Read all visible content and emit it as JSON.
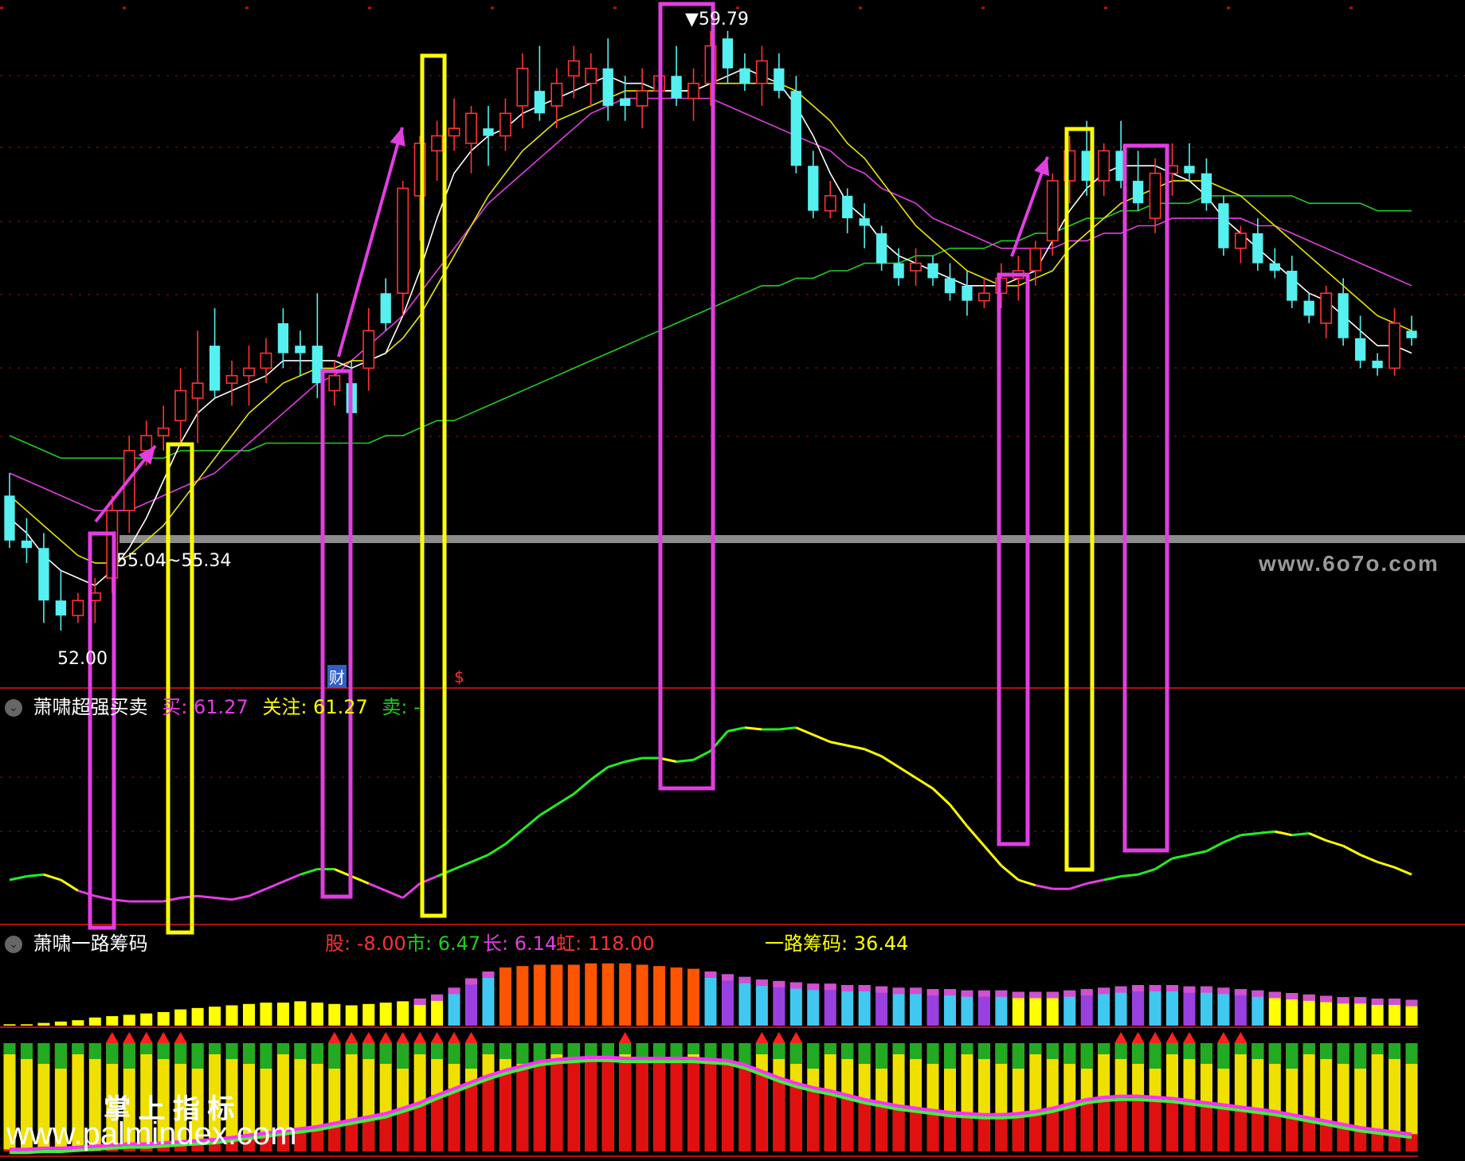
{
  "top_label": {
    "prefix": "▼",
    "price_high": "59.79",
    "price_mid": "55.04~55.34",
    "price_low": "52.00"
  },
  "markers": {
    "cai": "财",
    "s": "$"
  },
  "panel2": {
    "icon": "chevron-down-icon",
    "title": "萧啸超强买卖",
    "buy_label": "买: 61.27",
    "watch_label": "关注: 61.27",
    "sell_label": "卖: -"
  },
  "panel3": {
    "icon": "chevron-down-icon",
    "title": "萧啸一路筹码",
    "gu": "股: -8.00",
    "shi": "市: 6.47",
    "chang": "长: 6.14",
    "hong": "虹: 118.00",
    "yilu": "一路筹码: 36.44"
  },
  "watermarks": {
    "top": "www.6o7o.com",
    "cn": "掌 上 指 标",
    "bottom": "www.palmindex.com"
  },
  "colors": {
    "bg": "#000000",
    "up": "#ff3333",
    "down": "#55f0f0",
    "ma5": "#ffffff",
    "ma10": "#e8e800",
    "ma20": "#e23ee2",
    "ma60": "#22cc22",
    "box_magenta": "#e23ee2",
    "box_yellow": "#ffff00",
    "grid": "#8a1414"
  },
  "chart_data": [
    {
      "type": "candlestick",
      "title": "",
      "annotations": [
        "59.79",
        "55.04~55.34",
        "52.00"
      ],
      "ohlc": [
        [
          53.6,
          53.9,
          52.9,
          53.0
        ],
        [
          53.0,
          53.3,
          52.7,
          52.9
        ],
        [
          52.9,
          53.1,
          51.9,
          52.2
        ],
        [
          52.2,
          52.6,
          51.8,
          52.0
        ],
        [
          52.0,
          52.3,
          51.9,
          52.2
        ],
        [
          52.2,
          52.5,
          51.9,
          52.3
        ],
        [
          52.5,
          53.6,
          52.3,
          53.4
        ],
        [
          53.4,
          54.4,
          53.1,
          54.2
        ],
        [
          54.2,
          54.6,
          54.0,
          54.4
        ],
        [
          54.4,
          54.8,
          54.2,
          54.5
        ],
        [
          54.6,
          55.3,
          54.3,
          55.0
        ],
        [
          54.9,
          55.8,
          54.3,
          55.1
        ],
        [
          55.6,
          56.1,
          54.9,
          55.0
        ],
        [
          55.1,
          55.4,
          54.8,
          55.2
        ],
        [
          55.2,
          55.6,
          54.8,
          55.3
        ],
        [
          55.3,
          55.7,
          55.1,
          55.5
        ],
        [
          55.9,
          56.1,
          55.3,
          55.5
        ],
        [
          55.6,
          55.8,
          55.2,
          55.5
        ],
        [
          55.6,
          56.3,
          54.9,
          55.1
        ],
        [
          55.0,
          55.4,
          54.8,
          55.2
        ],
        [
          55.1,
          55.4,
          54.6,
          54.7
        ],
        [
          55.3,
          56.1,
          55.0,
          55.8
        ],
        [
          56.3,
          56.5,
          55.8,
          55.9
        ],
        [
          56.3,
          57.8,
          56.0,
          57.7
        ],
        [
          57.6,
          58.4,
          57.0,
          58.3
        ],
        [
          58.2,
          58.6,
          57.8,
          58.4
        ],
        [
          58.4,
          58.9,
          58.2,
          58.5
        ],
        [
          58.3,
          58.8,
          57.9,
          58.7
        ],
        [
          58.5,
          58.8,
          58.0,
          58.4
        ],
        [
          58.4,
          58.9,
          58.2,
          58.7
        ],
        [
          58.8,
          59.5,
          58.5,
          59.3
        ],
        [
          59.0,
          59.6,
          58.6,
          58.7
        ],
        [
          58.8,
          59.3,
          58.5,
          59.1
        ],
        [
          59.2,
          59.6,
          58.9,
          59.4
        ],
        [
          59.1,
          59.5,
          58.8,
          59.3
        ],
        [
          59.3,
          59.7,
          58.6,
          58.8
        ],
        [
          58.9,
          59.2,
          58.6,
          58.8
        ],
        [
          58.8,
          59.3,
          58.5,
          59.0
        ],
        [
          59.0,
          59.4,
          58.7,
          59.2
        ],
        [
          59.2,
          59.6,
          58.8,
          58.9
        ],
        [
          58.9,
          59.3,
          58.6,
          59.1
        ],
        [
          59.1,
          59.8,
          58.8,
          59.6
        ],
        [
          59.7,
          59.8,
          59.1,
          59.3
        ],
        [
          59.3,
          59.5,
          59.0,
          59.1
        ],
        [
          59.1,
          59.6,
          58.8,
          59.4
        ],
        [
          59.3,
          59.5,
          58.9,
          59.0
        ],
        [
          59.0,
          59.2,
          57.9,
          58.0
        ],
        [
          58.0,
          58.2,
          57.3,
          57.4
        ],
        [
          57.4,
          57.8,
          57.3,
          57.6
        ],
        [
          57.6,
          57.7,
          57.1,
          57.3
        ],
        [
          57.3,
          57.5,
          56.9,
          57.2
        ],
        [
          57.1,
          57.2,
          56.6,
          56.7
        ],
        [
          56.7,
          56.9,
          56.4,
          56.5
        ],
        [
          56.6,
          56.9,
          56.4,
          56.7
        ],
        [
          56.7,
          56.8,
          56.4,
          56.5
        ],
        [
          56.5,
          56.7,
          56.2,
          56.3
        ],
        [
          56.4,
          56.6,
          56.0,
          56.2
        ],
        [
          56.2,
          56.5,
          56.1,
          56.3
        ],
        [
          56.3,
          56.7,
          56.1,
          56.5
        ],
        [
          56.5,
          56.8,
          56.2,
          56.6
        ],
        [
          56.6,
          57.0,
          56.4,
          56.9
        ],
        [
          57.0,
          57.9,
          56.8,
          57.8
        ],
        [
          57.8,
          58.4,
          57.5,
          58.2
        ],
        [
          58.2,
          58.6,
          57.6,
          57.8
        ],
        [
          57.8,
          58.3,
          57.6,
          58.2
        ],
        [
          58.2,
          58.6,
          57.7,
          57.8
        ],
        [
          57.8,
          58.2,
          57.4,
          57.5
        ],
        [
          57.3,
          58.1,
          57.1,
          57.9
        ],
        [
          57.9,
          58.3,
          57.6,
          58.0
        ],
        [
          58.0,
          58.3,
          57.8,
          57.9
        ],
        [
          57.9,
          58.1,
          57.4,
          57.5
        ],
        [
          57.5,
          57.6,
          56.8,
          56.9
        ],
        [
          56.9,
          57.2,
          56.7,
          57.1
        ],
        [
          57.1,
          57.3,
          56.6,
          56.7
        ],
        [
          56.7,
          56.9,
          56.5,
          56.6
        ],
        [
          56.6,
          56.8,
          56.1,
          56.2
        ],
        [
          56.2,
          56.3,
          55.9,
          56.0
        ],
        [
          55.9,
          56.4,
          55.7,
          56.3
        ],
        [
          56.3,
          56.5,
          55.6,
          55.7
        ],
        [
          55.7,
          56.0,
          55.3,
          55.4
        ],
        [
          55.4,
          55.5,
          55.2,
          55.3
        ],
        [
          55.3,
          56.1,
          55.2,
          55.9
        ],
        [
          55.8,
          56.0,
          55.6,
          55.7
        ]
      ],
      "ma5": [
        53.3,
        53.1,
        52.8,
        52.6,
        52.5,
        52.4,
        52.6,
        52.9,
        53.3,
        53.8,
        54.3,
        54.7,
        54.9,
        55.0,
        55.1,
        55.2,
        55.4,
        55.4,
        55.4,
        55.4,
        55.3,
        55.4,
        55.5,
        56.0,
        56.6,
        57.3,
        57.9,
        58.2,
        58.4,
        58.5,
        58.7,
        58.8,
        58.9,
        59.0,
        59.1,
        59.2,
        59.1,
        59.1,
        59.0,
        59.0,
        59.0,
        59.1,
        59.2,
        59.3,
        59.2,
        59.1,
        58.8,
        58.4,
        57.9,
        57.5,
        57.3,
        57.0,
        56.8,
        56.7,
        56.6,
        56.5,
        56.4,
        56.4,
        56.4,
        56.5,
        56.6,
        57.0,
        57.4,
        57.7,
        57.9,
        58.0,
        58.0,
        58.0,
        57.9,
        57.8,
        57.6,
        57.3,
        57.1,
        56.9,
        56.7,
        56.5,
        56.3,
        56.2,
        56.0,
        55.8,
        55.6,
        55.6,
        55.5
      ],
      "ma10": [
        53.6,
        53.4,
        53.2,
        53.0,
        52.8,
        52.7,
        52.7,
        52.8,
        53.0,
        53.2,
        53.5,
        53.8,
        54.1,
        54.4,
        54.7,
        54.9,
        55.1,
        55.2,
        55.3,
        55.3,
        55.4,
        55.4,
        55.5,
        55.7,
        56.0,
        56.4,
        56.8,
        57.2,
        57.6,
        57.9,
        58.2,
        58.4,
        58.6,
        58.7,
        58.8,
        58.9,
        59.0,
        59.0,
        59.0,
        59.0,
        59.0,
        59.1,
        59.1,
        59.1,
        59.1,
        59.1,
        59.0,
        58.8,
        58.6,
        58.3,
        58.1,
        57.8,
        57.5,
        57.2,
        57.0,
        56.8,
        56.6,
        56.5,
        56.4,
        56.4,
        56.5,
        56.6,
        56.9,
        57.1,
        57.3,
        57.5,
        57.6,
        57.7,
        57.8,
        57.8,
        57.8,
        57.7,
        57.6,
        57.4,
        57.2,
        57.0,
        56.8,
        56.6,
        56.4,
        56.2,
        56.0,
        55.9,
        55.8
      ],
      "ma20": [
        53.9,
        53.8,
        53.7,
        53.6,
        53.5,
        53.4,
        53.4,
        53.4,
        53.5,
        53.6,
        53.7,
        53.8,
        53.9,
        54.1,
        54.3,
        54.5,
        54.7,
        54.9,
        55.1,
        55.2,
        55.4,
        55.6,
        55.8,
        56.0,
        56.3,
        56.6,
        56.9,
        57.2,
        57.5,
        57.7,
        57.9,
        58.1,
        58.3,
        58.5,
        58.7,
        58.8,
        58.9,
        58.9,
        58.9,
        58.9,
        58.9,
        58.9,
        58.8,
        58.7,
        58.6,
        58.5,
        58.4,
        58.3,
        58.2,
        58.0,
        57.9,
        57.7,
        57.6,
        57.5,
        57.3,
        57.2,
        57.1,
        57.0,
        56.9,
        56.9,
        56.9,
        56.9,
        57.0,
        57.0,
        57.1,
        57.1,
        57.2,
        57.2,
        57.3,
        57.3,
        57.3,
        57.3,
        57.3,
        57.2,
        57.2,
        57.1,
        57.0,
        56.9,
        56.8,
        56.7,
        56.6,
        56.5,
        56.4
      ],
      "ma60": [
        54.4,
        54.3,
        54.2,
        54.1,
        54.1,
        54.1,
        54.1,
        54.1,
        54.1,
        54.1,
        54.2,
        54.2,
        54.2,
        54.2,
        54.2,
        54.3,
        54.3,
        54.3,
        54.3,
        54.3,
        54.3,
        54.3,
        54.4,
        54.4,
        54.5,
        54.6,
        54.6,
        54.7,
        54.8,
        54.9,
        55.0,
        55.1,
        55.2,
        55.3,
        55.4,
        55.5,
        55.6,
        55.7,
        55.8,
        55.9,
        56.0,
        56.1,
        56.2,
        56.3,
        56.4,
        56.4,
        56.5,
        56.5,
        56.6,
        56.6,
        56.7,
        56.7,
        56.7,
        56.8,
        56.8,
        56.9,
        56.9,
        56.9,
        57.0,
        57.0,
        57.1,
        57.1,
        57.2,
        57.3,
        57.3,
        57.4,
        57.4,
        57.5,
        57.5,
        57.5,
        57.6,
        57.6,
        57.6,
        57.6,
        57.6,
        57.6,
        57.5,
        57.5,
        57.5,
        57.5,
        57.4,
        57.4,
        57.4
      ],
      "ylim": [
        51.5,
        60.0
      ]
    },
    {
      "type": "line",
      "title": "萧啸超强买卖",
      "series": [
        {
          "name": "买",
          "values": [
            20,
            22,
            23,
            20,
            14,
            11,
            9,
            8,
            8,
            8,
            10,
            11,
            10,
            9,
            11,
            15,
            19,
            23,
            26,
            26,
            22,
            18,
            14,
            10,
            18,
            22,
            26,
            30,
            34,
            40,
            48,
            56,
            62,
            68,
            76,
            83,
            86,
            88,
            88,
            86,
            87,
            92,
            103,
            105,
            104,
            104,
            105,
            101,
            97,
            95,
            93,
            89,
            83,
            77,
            71,
            62,
            50,
            39,
            28,
            20,
            17,
            15,
            15,
            18,
            20,
            22,
            23,
            26,
            32,
            34,
            36,
            41,
            45,
            46,
            47,
            45,
            46,
            42,
            39,
            34,
            30,
            27,
            23
          ]
        }
      ],
      "ylim": [
        0,
        120
      ]
    },
    {
      "type": "bar",
      "title": "萧啸一路筹码",
      "series": [
        {
          "name": "一路筹码",
          "values": [
            1,
            1,
            2,
            3,
            4,
            6,
            7,
            8,
            9,
            10,
            12,
            13,
            14,
            15,
            16,
            17,
            17,
            18,
            17,
            16,
            15,
            16,
            17,
            18,
            20,
            23,
            28,
            35,
            40,
            43,
            44,
            45,
            45,
            45,
            46,
            46,
            46,
            45,
            44,
            43,
            42,
            40,
            38,
            36,
            34,
            33,
            32,
            31,
            31,
            30,
            30,
            29,
            28,
            28,
            27,
            27,
            26,
            26,
            26,
            25,
            25,
            25,
            26,
            27,
            28,
            29,
            30,
            30,
            30,
            29,
            29,
            28,
            27,
            26,
            25,
            24,
            23,
            22,
            21,
            21,
            20,
            20,
            19
          ]
        },
        {
          "name": "一路线",
          "values": [
            2,
            2,
            3,
            3,
            4,
            5,
            6,
            7,
            7,
            8,
            9,
            10,
            11,
            13,
            15,
            17,
            19,
            21,
            23,
            26,
            29,
            32,
            35,
            40,
            45,
            52,
            58,
            64,
            70,
            75,
            79,
            83,
            85,
            86,
            87,
            87,
            86,
            86,
            86,
            86,
            86,
            85,
            84,
            80,
            74,
            68,
            63,
            59,
            56,
            52,
            48,
            45,
            42,
            40,
            38,
            36,
            35,
            34,
            34,
            35,
            37,
            40,
            44,
            48,
            50,
            51,
            51,
            50,
            49,
            47,
            45,
            43,
            41,
            39,
            37,
            34,
            31,
            28,
            25,
            22,
            20,
            18,
            16
          ]
        }
      ],
      "ylim": [
        0,
        100
      ]
    }
  ]
}
